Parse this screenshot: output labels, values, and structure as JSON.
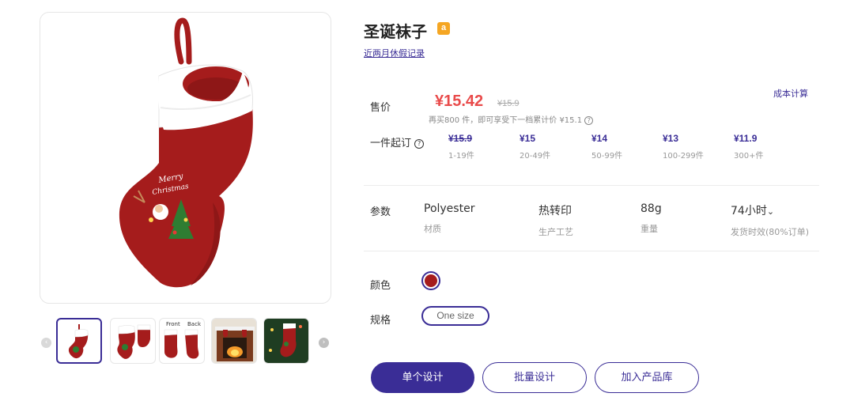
{
  "product": {
    "title": "圣诞袜子",
    "badge_letter": "a",
    "holiday_link": "近两月休假记录",
    "cost_link": "成本计算"
  },
  "pricing": {
    "label": "售价",
    "price": "¥15.42",
    "old_price": "¥15.9",
    "note": "再买800 件，即可享受下一档累计价 ¥15.1",
    "moq_label": "一件起订",
    "tiers": [
      {
        "price": "¥15.9",
        "qty": "1-19件",
        "strike": true
      },
      {
        "price": "¥15",
        "qty": "20-49件",
        "strike": false
      },
      {
        "price": "¥14",
        "qty": "50-99件",
        "strike": false
      },
      {
        "price": "¥13",
        "qty": "100-299件",
        "strike": false
      },
      {
        "price": "¥11.9",
        "qty": "300+件",
        "strike": false
      }
    ]
  },
  "params": {
    "label": "参数",
    "items": [
      {
        "value": "Polyester",
        "key": "材质"
      },
      {
        "value": "热转印",
        "key": "生产工艺"
      },
      {
        "value": "88g",
        "key": "重量"
      },
      {
        "value": "74小时",
        "key": "发货时效(80%订单)",
        "chevron": "⌄"
      }
    ]
  },
  "options": {
    "color_label": "颜色",
    "selected_color": "#a51c1c",
    "size_label": "规格",
    "size_value": "One size"
  },
  "gallery": {
    "thumb_labels": {
      "front": "Front",
      "back": "Back"
    },
    "stocking_text_1": "Merry",
    "stocking_text_2": "Christmas"
  },
  "actions": {
    "single_design": "单个设计",
    "batch_design": "批量设计",
    "add_to_library": "加入产品库"
  },
  "colors": {
    "accent": "#3a2d96",
    "price_red": "#e94b4b",
    "stocking_red": "#a51c1c",
    "badge_orange": "#f5a623"
  }
}
